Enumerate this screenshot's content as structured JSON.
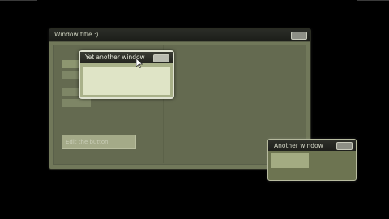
{
  "main_window": {
    "title": "Window title :)",
    "edit_button_label": "Edit the button"
  },
  "yet_another_window": {
    "title": "Yet another window"
  },
  "another_window": {
    "title": "Another window"
  },
  "colors": {
    "window_body": "#71785a",
    "titlebar": "#1c1d19",
    "highlight_window": "#a9b189"
  }
}
